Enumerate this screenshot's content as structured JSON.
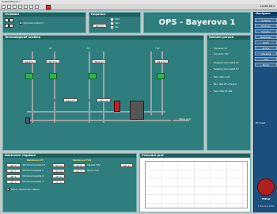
{
  "menubar": {
    "items": [
      "Soubor",
      "Hlavní",
      "?"
    ]
  },
  "toolbar": {
    "time": "14:08:58 ů"
  },
  "ovladani": {
    "title": "Ovládání",
    "checkbox_label": "Vyhodnocování UT"
  },
  "regulace": {
    "title": "Regulace",
    "value": "60.4 °C",
    "legend": [
      "Mód",
      "Stav",
      "Kor."
    ]
  },
  "banner": {
    "title": "OPS - Bayerova 1"
  },
  "schema": {
    "title": "Technologické schéma",
    "branches": [
      "UT",
      "TV",
      "TUV"
    ],
    "readings": {
      "ut_a": "61.6 °C",
      "ut_b": "56.3 °C",
      "tv_a": "58.6 °C",
      "tuv_a": "49.9 °C",
      "mid_a": "54.4 °C",
      "mid_b": "12.5 °C"
    },
    "bottom_label": "Vstup vody"
  },
  "seznam": {
    "title": "Seznam poruch",
    "items": [
      "Čerpadlo UT",
      "Čerpadlo TUV",
      "Havarijní termostat UT",
      "Havarijní termostat TV",
      "Max. tlak v síti",
      "Min. tlak ÚT ochrana",
      "Max. tlak ÚT sítě"
    ]
  },
  "nastaveni": {
    "title": "Nastavení regulace",
    "sections": [
      "Nastavení ÚT",
      "Nastavení TUV"
    ],
    "ut_rows": [
      {
        "label": "Útlumová teplota UT",
        "value": "48 °C",
        "v2": "20 °C"
      },
      {
        "label": "Útlumová teplota 1",
        "value": "48 °C",
        "v2": "20 °C"
      },
      {
        "label": "Útlumová teplota 2",
        "value": "48 °C",
        "v2": "20 °C"
      },
      {
        "label": "Útlumová teplota 3",
        "value": "48 °C",
        "v2": "20 °C"
      }
    ],
    "tuv_rows": [
      {
        "label": "Teplota TUV",
        "value": "55 °C"
      },
      {
        "label": "Útlum TUV",
        "value": "40 °C"
      }
    ],
    "footer_label": "Posun útlumového dělkač",
    "right_value": "55 °C"
  },
  "graf": {
    "title": "Průvodní graf"
  },
  "navigace": {
    "title": "Navigace",
    "buttons": [
      "Schéma",
      "Hodnoty",
      "Poruchy",
      "Nastavení",
      "Grafy",
      "Archiv",
      "Uživatelé",
      "Tisk",
      "Konec"
    ],
    "status": "PC hlasit",
    "logo_text": "TEPLO",
    "footer": "© Pracovní dotaz"
  },
  "colors": {
    "schema_bg": "#2e7e7e",
    "header_bg": "#1f5f5f",
    "nav_bg": "#1d4f7e",
    "pump": "#2fb64a",
    "boiler": "#c0202c"
  }
}
